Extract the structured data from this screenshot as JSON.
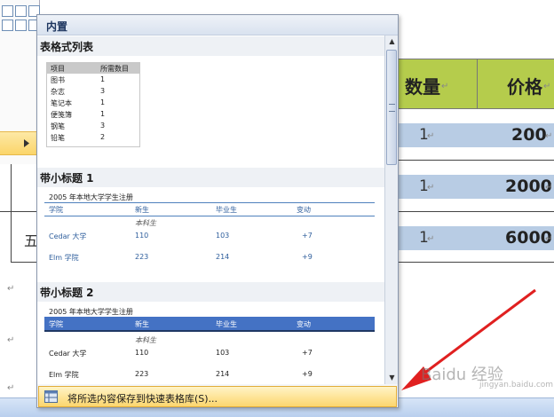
{
  "document": {
    "table_headers": {
      "quantity": "数量",
      "price": "价格"
    },
    "row_char": "五",
    "rows": [
      {
        "quantity": "1",
        "price": "200"
      },
      {
        "quantity": "1",
        "price": "2000"
      },
      {
        "quantity": "1",
        "price": "6000"
      }
    ],
    "return_mark": "↵",
    "para_mark": "↵"
  },
  "gallery": {
    "header": "内置",
    "sections": [
      {
        "title": "表格式列表",
        "preview": {
          "columns": [
            "项目",
            "所需数目"
          ],
          "rows": [
            [
              "图书",
              "1"
            ],
            [
              "杂志",
              "3"
            ],
            [
              "笔记本",
              "1"
            ],
            [
              "便笺簿",
              "1"
            ],
            [
              "钢笔",
              "3"
            ],
            [
              "铅笔",
              "2"
            ]
          ]
        }
      },
      {
        "title": "带小标题 1",
        "preview": {
          "caption": "2005 年本地大学学生注册",
          "columns": [
            "学院",
            "新生",
            "毕业生",
            "变动"
          ],
          "subheading": "本科生",
          "rows": [
            [
              "Cedar 大学",
              "110",
              "103",
              "+7"
            ],
            [
              "Elm 学院",
              "223",
              "214",
              "+9"
            ]
          ]
        }
      },
      {
        "title": "带小标题 2",
        "preview": {
          "caption": "2005 年本地大学学生注册",
          "columns": [
            "学院",
            "新生",
            "毕业生",
            "变动"
          ],
          "subheading": "本科生",
          "rows": [
            [
              "Cedar 大学",
              "110",
              "103",
              "+7"
            ],
            [
              "Elm 学院",
              "223",
              "214",
              "+9"
            ]
          ]
        }
      }
    ],
    "save_action": "将所选内容保存到快速表格库(S)..."
  },
  "watermark": {
    "text": "Baidu 经验",
    "sub": "jingyan.baidu.com"
  },
  "colors": {
    "header_green": "#b5cc4c",
    "row_blue": "#b8cce4",
    "highlight": "#fcd66e",
    "arrow_red": "#e02020"
  }
}
